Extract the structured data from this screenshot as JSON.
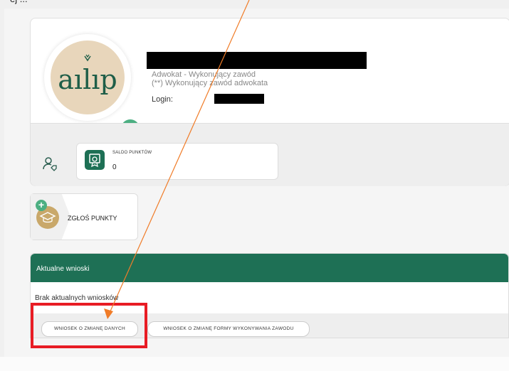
{
  "profile": {
    "role": "Adwokat - Wykonujący zawód",
    "status": "(**) Wykonujący zawód adwokata",
    "login_label": "Login:",
    "logo_icon": "aiip-logo",
    "settings_icon": "gear-icon"
  },
  "saldo": {
    "label": "SALDO PUNKTÓW",
    "value": "0",
    "icon": "certificate-icon"
  },
  "zglos": {
    "label": "ZGŁOŚ PUNKTY",
    "icon": "graduation-cap-icon"
  },
  "wnioski": {
    "title": "Aktualne wnioski",
    "empty_text": "Brak aktualnych wniosków",
    "buttons": [
      {
        "label": "WNIOSEK O ZMIANĘ DANYCH"
      },
      {
        "label": "WNIOSEK O ZMIANĘ FORMY WYKONYWANIA ZAWODU"
      }
    ]
  },
  "colors": {
    "brand_green": "#1e7055",
    "accent_green": "#4caf82",
    "beige": "#e8d6bb",
    "gold": "#c9a86a",
    "highlight_red": "#e81c24",
    "arrow_orange": "#f07c28"
  }
}
